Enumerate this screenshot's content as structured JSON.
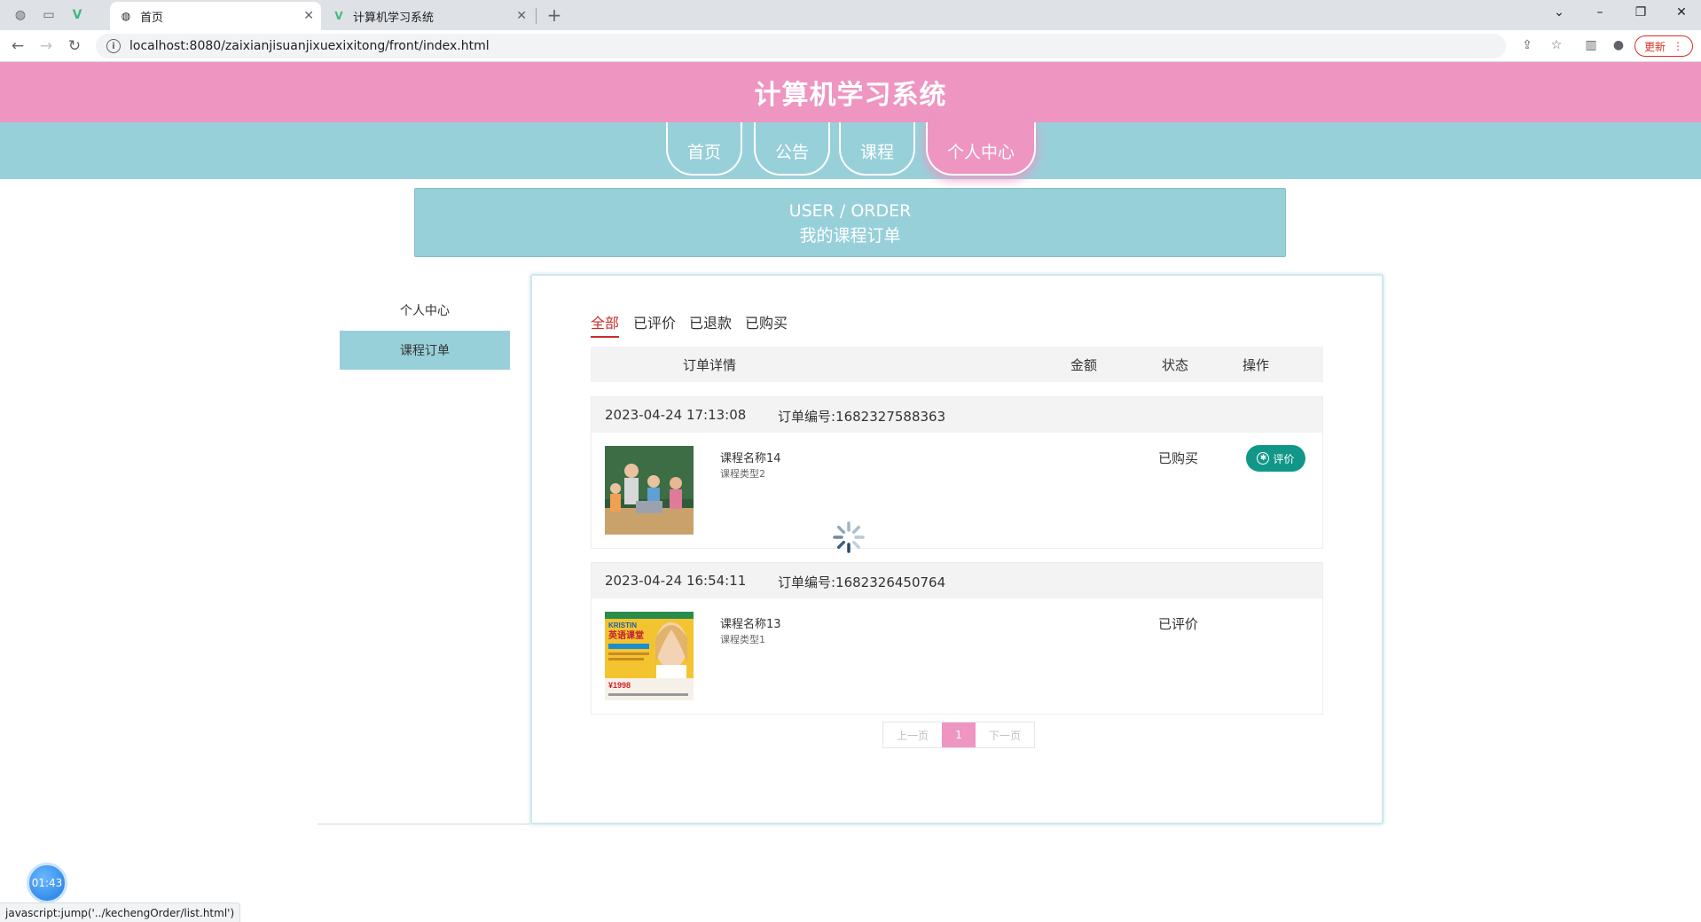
{
  "browser": {
    "tabs": [
      {
        "title": "首页",
        "icon": "globe-icon",
        "active": true
      },
      {
        "title": "计算机学习系统",
        "icon": "vue-logo-icon",
        "active": false
      }
    ],
    "url": "localhost:8080/zaixianjisuanjixuexixitong/front/index.html",
    "update_label": "更新"
  },
  "site": {
    "title": "计算机学习系统",
    "nav": [
      "首页",
      "公告",
      "课程",
      "个人中心"
    ],
    "nav_active": "个人中心"
  },
  "banner": {
    "en": "USER / ORDER",
    "cn": "我的课程订单"
  },
  "sidebar": {
    "items": [
      "个人中心",
      "课程订单"
    ],
    "active": "课程订单"
  },
  "filters": {
    "tabs": [
      "全部",
      "已评价",
      "已退款",
      "已购买"
    ],
    "active": "全部"
  },
  "table": {
    "headers": [
      "订单详情",
      "金额",
      "状态",
      "操作"
    ]
  },
  "orders": [
    {
      "date": "2023-04-24 17:13:08",
      "order_no": "订单编号:1682327588363",
      "course_name": "课程名称14",
      "course_type": "课程类型2",
      "status": "已购买",
      "action": "评价"
    },
    {
      "date": "2023-04-24 16:54:11",
      "order_no": "订单编号:1682326450764",
      "course_name": "课程名称13",
      "course_type": "课程类型1",
      "status": "已评价",
      "action": ""
    }
  ],
  "thumb2": {
    "brand": "KRISTIN",
    "title": "英语课堂",
    "price": "¥1998"
  },
  "pagination": {
    "prev": "上一页",
    "current": "1",
    "next": "下一页"
  },
  "timer": "01:43",
  "statusbar": "javascript:jump('../kechengOrder/list.html')",
  "colors": {
    "header_pink": "#ee95c2",
    "nav_teal": "#98d0da",
    "action_green": "#119788",
    "active_red": "#c9302c"
  }
}
